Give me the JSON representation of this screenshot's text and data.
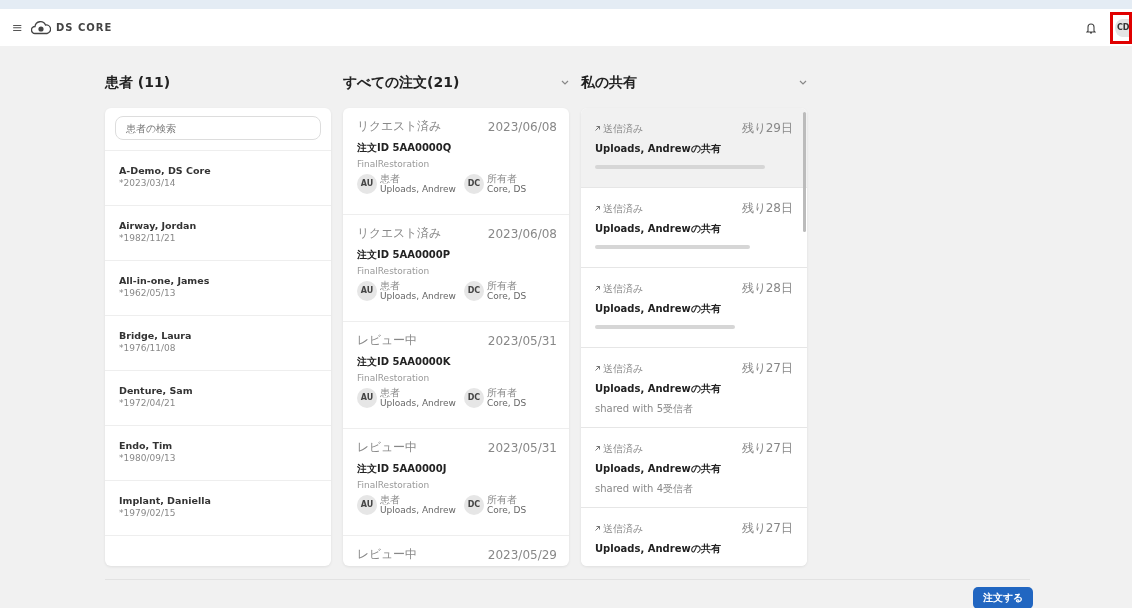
{
  "header": {
    "menu_icon": "≡",
    "logo": "DS CORE",
    "avatar": "CD",
    "avatar_highlighted": true
  },
  "patients": {
    "title": "患者 (11)",
    "search": {
      "placeholder": "患者の検索"
    },
    "rows": [
      {
        "name": "A-Demo, DS Core",
        "birth": "*2023/03/14"
      },
      {
        "name": "Airway, Jordan",
        "birth": "*1982/11/21"
      },
      {
        "name": "All-in-one, James",
        "birth": "*1962/05/13"
      },
      {
        "name": "Bridge, Laura",
        "birth": "*1976/11/08"
      },
      {
        "name": "Denture, Sam",
        "birth": "*1972/04/21"
      },
      {
        "name": "Endo, Tim",
        "birth": "*1980/09/13"
      },
      {
        "name": "Implant, Daniella",
        "birth": "*1979/02/15"
      }
    ]
  },
  "orders": {
    "title": "すべての注文(21)",
    "cards": [
      {
        "status": "リクエスト済み",
        "date": "2023/06/08",
        "id": "注文ID 5AA0000Q",
        "type": "FinalRestoration",
        "patient_initials": "AU",
        "patient_label": "患者",
        "patient": "Uploads, Andrew",
        "owner_initials": "DC",
        "owner_label": "所有者",
        "owner": "Core, DS"
      },
      {
        "status": "リクエスト済み",
        "date": "2023/06/08",
        "id": "注文ID 5AA0000P",
        "type": "FinalRestoration",
        "patient_initials": "AU",
        "patient_label": "患者",
        "patient": "Uploads, Andrew",
        "owner_initials": "DC",
        "owner_label": "所有者",
        "owner": "Core, DS"
      },
      {
        "status": "レビュー中",
        "date": "2023/05/31",
        "id": "注文ID 5AA0000K",
        "type": "FinalRestoration",
        "patient_initials": "AU",
        "patient_label": "患者",
        "patient": "Uploads, Andrew",
        "owner_initials": "DC",
        "owner_label": "所有者",
        "owner": "Core, DS"
      },
      {
        "status": "レビュー中",
        "date": "2023/05/31",
        "id": "注文ID 5AA0000J",
        "type": "FinalRestoration",
        "patient_initials": "AU",
        "patient_label": "患者",
        "patient": "Uploads, Andrew",
        "owner_initials": "DC",
        "owner_label": "所有者",
        "owner": "Core, DS"
      },
      {
        "status": "レビュー中",
        "date": "2023/05/29"
      }
    ]
  },
  "shares": {
    "title": "私の共有",
    "cards": [
      {
        "status": "送信済み",
        "remaining": "残り29日",
        "title": "Uploads, Andrewの共有",
        "kind": "blurred",
        "selected": true
      },
      {
        "status": "送信済み",
        "remaining": "残り28日",
        "title": "Uploads, Andrewの共有",
        "kind": "blurred",
        "selected": false
      },
      {
        "status": "送信済み",
        "remaining": "残り28日",
        "title": "Uploads, Andrewの共有",
        "kind": "blurred",
        "selected": false
      },
      {
        "status": "送信済み",
        "remaining": "残り27日",
        "title": "Uploads, Andrewの共有",
        "kind": "text",
        "recipients": "shared with 5受信者",
        "selected": false
      },
      {
        "status": "送信済み",
        "remaining": "残り27日",
        "title": "Uploads, Andrewの共有",
        "kind": "text",
        "recipients": "shared with 4受信者",
        "selected": false
      },
      {
        "status": "送信済み",
        "remaining": "残り27日",
        "title": "Uploads, Andrewの共有",
        "selected": false
      }
    ]
  },
  "order_button": "注文する"
}
